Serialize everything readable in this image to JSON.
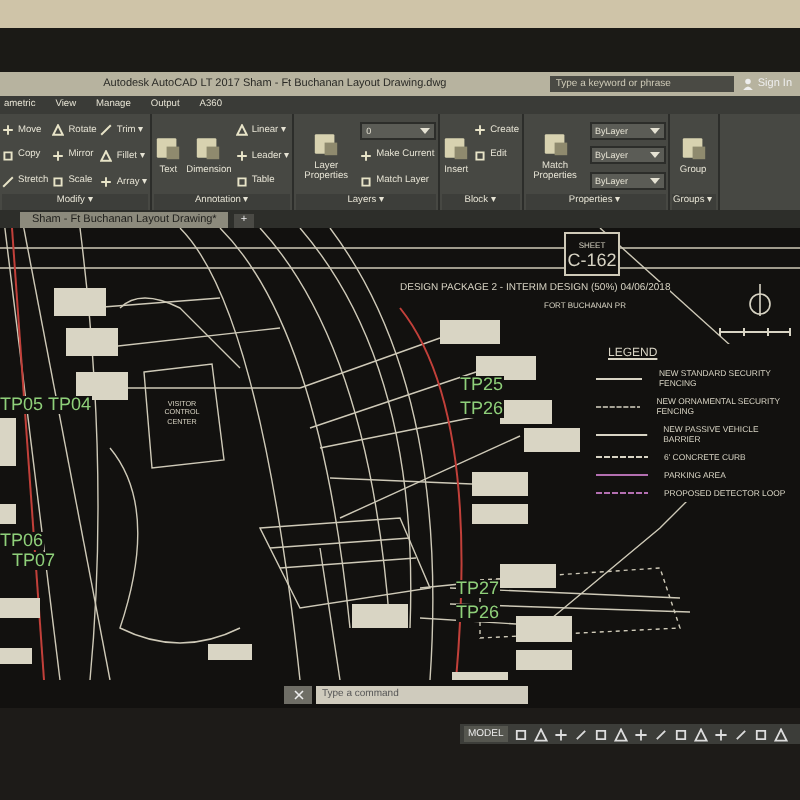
{
  "window": {
    "title": "Autodesk AutoCAD LT 2017   Sham - Ft Buchanan Layout Drawing.dwg",
    "search": {
      "placeholder": "Type a keyword or phrase"
    },
    "sign_in": "Sign In"
  },
  "ribbon_tabs": [
    "ametric",
    "View",
    "Manage",
    "Output",
    "A360"
  ],
  "panels": [
    {
      "title": "Modify ▾",
      "tools": [
        {
          "kind": "small",
          "label": "Move"
        },
        {
          "kind": "small",
          "label": "Copy"
        },
        {
          "kind": "small",
          "label": "Stretch"
        },
        {
          "kind": "small",
          "label": "Rotate"
        },
        {
          "kind": "small",
          "label": "Mirror"
        },
        {
          "kind": "small",
          "label": "Scale"
        },
        {
          "kind": "small",
          "label": "Trim ▾"
        },
        {
          "kind": "small",
          "label": "Fillet ▾"
        },
        {
          "kind": "small",
          "label": "Array ▾"
        }
      ]
    },
    {
      "title": "Annotation ▾",
      "tools": [
        {
          "kind": "large",
          "label": "Text"
        },
        {
          "kind": "large",
          "label": "Dimension"
        },
        {
          "kind": "small",
          "label": "Linear ▾"
        },
        {
          "kind": "small",
          "label": "Leader ▾"
        },
        {
          "kind": "small",
          "label": "Table"
        }
      ]
    },
    {
      "title": "Layers ▾",
      "tools": [
        {
          "kind": "large",
          "label": "Layer Properties"
        },
        {
          "kind": "dropdown",
          "label": "0"
        },
        {
          "kind": "small",
          "label": "Make Current"
        },
        {
          "kind": "small",
          "label": "Match Layer"
        }
      ]
    },
    {
      "title": "Block ▾",
      "tools": [
        {
          "kind": "large",
          "label": "Insert"
        },
        {
          "kind": "small",
          "label": "Create"
        },
        {
          "kind": "small",
          "label": "Edit"
        }
      ]
    },
    {
      "title": "Properties ▾",
      "tools": [
        {
          "kind": "large",
          "label": "Match Properties"
        },
        {
          "kind": "dropdown",
          "label": "ByLayer"
        },
        {
          "kind": "dropdown",
          "label": "ByLayer"
        },
        {
          "kind": "dropdown",
          "label": "ByLayer"
        }
      ]
    },
    {
      "title": "Groups ▾",
      "tools": [
        {
          "kind": "large",
          "label": "Group"
        }
      ]
    }
  ],
  "file_tab": {
    "label": "Sham - Ft Buchanan Layout Drawing*",
    "new_tab": "+"
  },
  "drawing": {
    "sheet_label": "SHEET",
    "sheet_number": "C-162",
    "header": "DESIGN PACKAGE 2 - INTERIM DESIGN (50%) 04/06/2018",
    "location": "FORT BUCHANAN PR",
    "building_label": "VISITOR CONTROL CENTER",
    "point_labels": [
      "TP05",
      "TP04",
      "TP06",
      "TP07",
      "TP25",
      "TP26",
      "TP27",
      "TP26"
    ],
    "legend": {
      "title": "LEGEND",
      "items": [
        "NEW STANDARD SECURITY FENCING",
        "NEW ORNAMENTAL SECURITY FENCING",
        "NEW PASSIVE VEHICLE BARRIER",
        "6' CONCRETE CURB",
        "PARKING AREA",
        "PROPOSED DETECTOR LOOP"
      ]
    }
  },
  "command_line": {
    "placeholder": "Type a command"
  },
  "status_bar": {
    "mode": "MODEL"
  }
}
